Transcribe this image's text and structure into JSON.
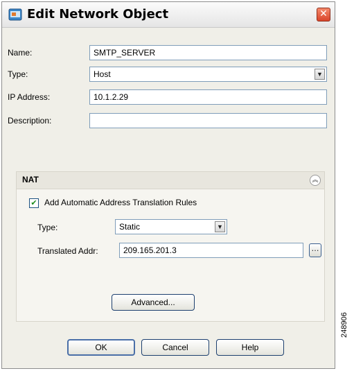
{
  "dialog": {
    "title": "Edit Network Object",
    "close_glyph": "✕",
    "title_icon": "network-object-icon"
  },
  "form": {
    "name_label": "Name:",
    "name_value": "SMTP_SERVER",
    "type_label": "Type:",
    "type_value": "Host",
    "ip_label": "IP Address:",
    "ip_value": "10.1.2.29",
    "description_label": "Description:",
    "description_value": ""
  },
  "nat": {
    "title": "NAT",
    "collapse_glyph": "︽",
    "auto_rules_checked": true,
    "auto_rules_label": "Add Automatic Address Translation Rules",
    "type_label": "Type:",
    "type_value": "Static",
    "translated_label": "Translated Addr:",
    "translated_value": "209.165.201.3",
    "browse_glyph": "…",
    "advanced_label": "Advanced..."
  },
  "buttons": {
    "ok": "OK",
    "cancel": "Cancel",
    "help": "Help"
  },
  "figure_id": "248906",
  "colors": {
    "dialog_bg": "#f0efe8",
    "close_button": "#d9452a",
    "field_border": "#7f9db9",
    "check_mark": "#1a8a1a"
  }
}
